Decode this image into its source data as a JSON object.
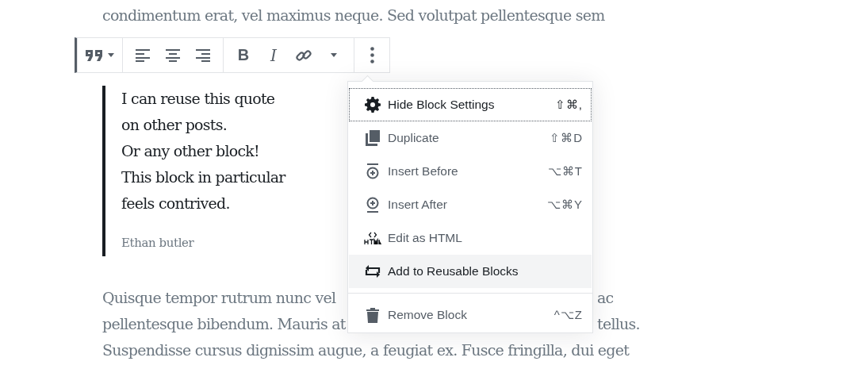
{
  "paragraph_above": {
    "text": "condimentum erat, vel maximus neque. Sed volutpat pellentesque sem"
  },
  "toolbar": {
    "groups": [
      [
        {
          "kind": "block-type"
        }
      ],
      [
        {
          "kind": "align-left"
        },
        {
          "kind": "align-center"
        },
        {
          "kind": "align-right"
        }
      ],
      [
        {
          "kind": "bold",
          "label": "B"
        },
        {
          "kind": "italic",
          "label": "I"
        },
        {
          "kind": "link"
        },
        {
          "kind": "more-formatting"
        }
      ],
      [
        {
          "kind": "more-options"
        }
      ]
    ]
  },
  "quote": {
    "lines": [
      "I can reuse this quote",
      "on other posts.",
      "Or any other block!",
      "This block in particular",
      "feels contrived."
    ],
    "citation": "Ethan butler"
  },
  "paragraph_below": {
    "lines": [
      {
        "start": "Quisque tempor rutrum nunc vel",
        "end": "ac"
      },
      {
        "start": "pellentesque bibendum. Mauris at",
        "end": "tellus."
      },
      {
        "start": "Suspendisse cursus dignissim augue, a feugiat ex. Fusce fringilla, dui eget"
      }
    ]
  },
  "menu": {
    "groups": [
      [
        {
          "label": "Hide Block Settings",
          "shortcut": "⇧⌘,",
          "focused": true,
          "highlighted": false
        },
        {
          "label": "Duplicate",
          "shortcut": "⇧⌘D",
          "focused": false,
          "highlighted": false
        },
        {
          "label": "Insert Before",
          "shortcut": "⌥⌘T",
          "focused": false,
          "highlighted": false
        },
        {
          "label": "Insert After",
          "shortcut": "⌥⌘Y",
          "focused": false,
          "highlighted": false
        },
        {
          "label": "Edit as HTML",
          "focused": false,
          "highlighted": false
        },
        {
          "label": "Add to Reusable Blocks",
          "focused": false,
          "highlighted": true
        }
      ],
      [
        {
          "label": "Remove Block",
          "shortcut": "^⌥Z",
          "focused": false,
          "highlighted": false
        }
      ]
    ]
  }
}
